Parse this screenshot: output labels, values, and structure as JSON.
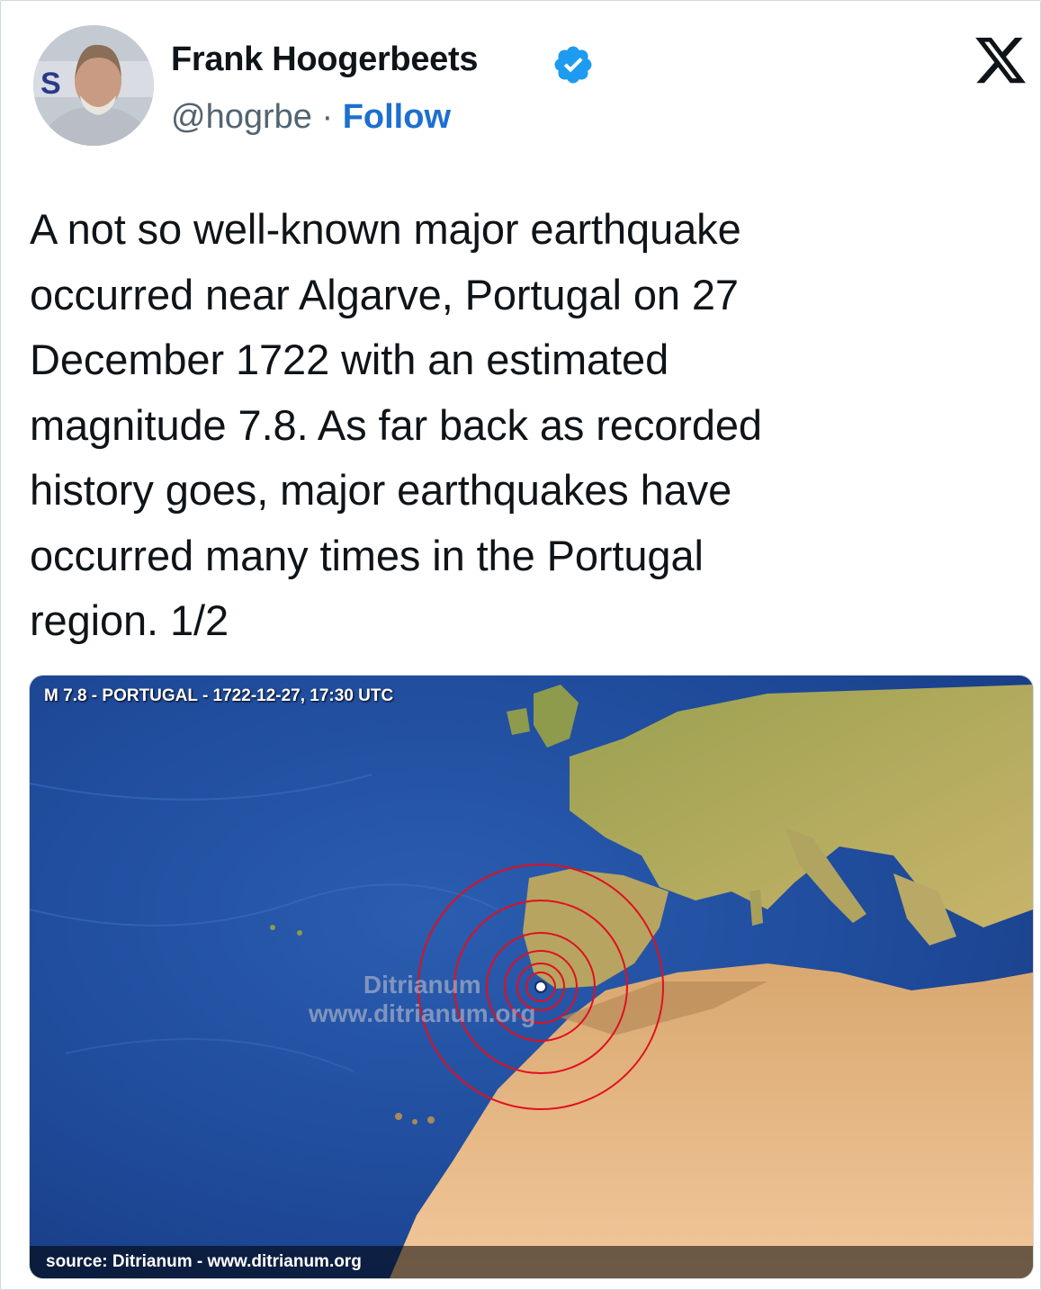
{
  "author": {
    "name": "Frank Hoogerbeets",
    "handle": "@hogrbe",
    "separator": "·",
    "follow_label": "Follow",
    "verified_icon": "verified-badge-icon",
    "avatar_letters": "S",
    "avatar_icon": "profile-photo"
  },
  "brand": {
    "logo": "x-logo-icon"
  },
  "tweet": {
    "text": "A not so well-known major earthquake\noccurred near Algarve, Portugal on 27\nDecember 1722 with an estimated\nmagnitude 7.8. As far back as recorded\nhistory goes, major earthquakes have\noccurred many times in the Portugal\nregion. 1/2"
  },
  "media": {
    "title": "M 7.8 - PORTUGAL - 1722-12-27, 17:30 UTC",
    "source": "source: Ditrianum - www.ditrianum.org",
    "watermark_line1": "Ditrianum",
    "watermark_line2": "www.ditrianum.org",
    "epicenter_icon": "epicenter-marker-icon"
  },
  "colors": {
    "follow": "#1d6fd0",
    "verified": "#1d9bf0",
    "ocean": "#1f4a9a",
    "land": "#c9a96a",
    "rings": "#e01020"
  }
}
